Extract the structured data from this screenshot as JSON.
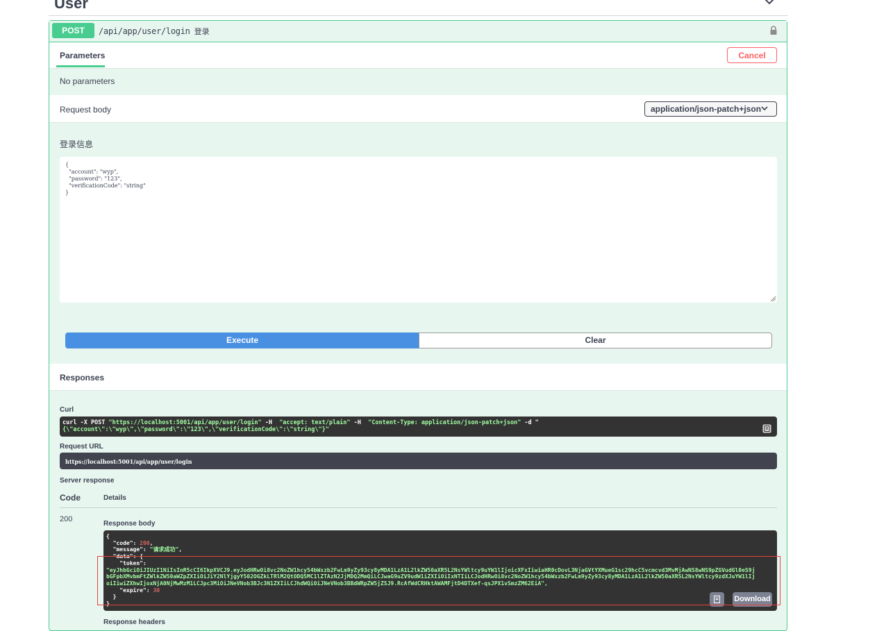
{
  "tag": {
    "title": "User"
  },
  "operation": {
    "method": "POST",
    "path": "/api/app/user/login",
    "description": "登录"
  },
  "parameters": {
    "tab_label": "Parameters",
    "cancel_label": "Cancel",
    "no_params": "No parameters"
  },
  "request_body": {
    "label": "Request body",
    "content_type": "application/json-patch+json",
    "description": "登录信息",
    "json_lines": [
      "{",
      "  \"account\": \"wyp\",",
      "  \"password\": \"123\",",
      "  \"verificationCode\": \"string\"",
      "}"
    ]
  },
  "buttons": {
    "execute": "Execute",
    "clear": "Clear"
  },
  "responses": {
    "label": "Responses",
    "curl_label": "Curl",
    "curl_cmd": "curl -X POST ",
    "curl_url": "\"https://localhost:5001/api/app/user/login\"",
    "curl_h": " -H  ",
    "curl_accept": "\"accept: text/plain\"",
    "curl_h2": " -H  ",
    "curl_ctype": "\"Content-Type: application/json-patch+json\"",
    "curl_d": " -d \"",
    "curl_data": "{\\\"account\\\":\\\"wyp\\\",\\\"password\\\":\\\"123\\\",\\\"verificationCode\\\":\\\"string\\\"}\"",
    "request_url_label": "Request URL",
    "request_url": "https://localhost:5001/api/app/user/login",
    "server_response_label": "Server response",
    "code_header": "Code",
    "details_header": "Details",
    "code": "200",
    "response_body_label": "Response body",
    "response_headers_label": "Response headers",
    "download_label": "Download",
    "body": {
      "code": "200",
      "message": "\"请求成功\"",
      "token_line1": "\"eyJhbGciOiJIUzI1NiIsInR5cCI6IkpXVCJ9.eyJodHRwOi8vc2NoZW1hcy54bWxzb2FwLm9yZy93cy8yMDA1LzA1L2lkZW50aXR5L2NsYWltcy9uYW1lIjoicXFxIiwiaHR0cDovL3NjaGVtYXMueG1sc29hcC5vcmcvd3MvMjAwNS8wNS9pZGVudGl0eS9j",
      "token_line2": "bGFpbXMvbmFtZWlkZW50aWZpZXIiOiJiY2NlYjgyY502OGZkLTRlM2QtODQ5MC1lZTAzN2JjMDQ2MmQiLCJwaG9uZV9udW1iZXIiOiIxNTIiLCJodHRwOi8vc2NoZW1hcy54bWxzb2FwLm9yZy93cy8yMDA1LzA1L2lkZW50aXR5L2NsYWltcy9zdXJuYW1lIj",
      "token_line3": "oiIiwiZXhwIjoxNjA0NjMwMzM1LCJpc3MiOiJNeVNob3BJc3N1ZXIiLCJhdWQiOiJNeVNob3BBdWRpZW5jZSJ9.RcAfWdCRHktAWAMFjtD4DTXef-qsJPX1vSmzZM62EiA\",",
      "expire": "30"
    }
  }
}
